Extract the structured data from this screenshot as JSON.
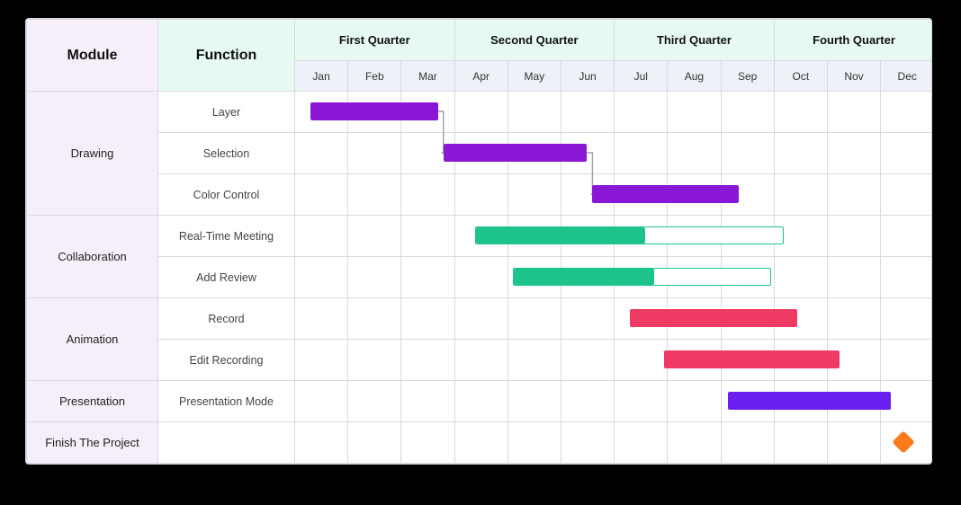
{
  "headers": {
    "module": "Module",
    "function": "Function",
    "quarters": [
      "First Quarter",
      "Second Quarter",
      "Third Quarter",
      "Fourth Quarter"
    ],
    "months": [
      "Jan",
      "Feb",
      "Mar",
      "Apr",
      "May",
      "Jun",
      "Jul",
      "Aug",
      "Sep",
      "Oct",
      "Nov",
      "Dec"
    ]
  },
  "modules": [
    {
      "name": "Drawing",
      "rows": [
        "Layer",
        "Selection",
        "Color Control"
      ]
    },
    {
      "name": "Collaboration",
      "rows": [
        "Real-Time Meeting",
        "Add Review"
      ]
    },
    {
      "name": "Animation",
      "rows": [
        "Record",
        "Edit Recording"
      ]
    },
    {
      "name": "Presentation",
      "rows": [
        "Presentation Mode"
      ]
    },
    {
      "name": "Finish The Project",
      "rows": [
        ""
      ]
    }
  ],
  "colors": {
    "drawing": "#8b17d6",
    "collab": "#1cc48a",
    "anim": "#ef3a63",
    "present": "#6a1ef0",
    "milestone": "#ff7a1a"
  },
  "chart_data": {
    "type": "bar",
    "subtype": "gantt",
    "x_categories": [
      "Jan",
      "Feb",
      "Mar",
      "Apr",
      "May",
      "Jun",
      "Jul",
      "Aug",
      "Sep",
      "Oct",
      "Nov",
      "Dec"
    ],
    "tasks": [
      {
        "module": "Drawing",
        "function": "Layer",
        "start": 0.3,
        "end": 2.7,
        "color": "drawing",
        "progress": 1.0
      },
      {
        "module": "Drawing",
        "function": "Selection",
        "start": 2.8,
        "end": 5.5,
        "color": "drawing",
        "progress": 1.0
      },
      {
        "module": "Drawing",
        "function": "Color Control",
        "start": 5.6,
        "end": 8.35,
        "color": "drawing",
        "progress": 1.0
      },
      {
        "module": "Collaboration",
        "function": "Real-Time Meeting",
        "start": 3.4,
        "end": 9.2,
        "color": "collab",
        "progress": 0.55
      },
      {
        "module": "Collaboration",
        "function": "Add Review",
        "start": 4.1,
        "end": 8.95,
        "color": "collab",
        "progress": 0.55
      },
      {
        "module": "Animation",
        "function": "Record",
        "start": 6.3,
        "end": 9.45,
        "color": "anim",
        "progress": 1.0
      },
      {
        "module": "Animation",
        "function": "Edit Recording",
        "start": 6.95,
        "end": 10.25,
        "color": "anim",
        "progress": 1.0
      },
      {
        "module": "Presentation",
        "function": "Presentation Mode",
        "start": 8.15,
        "end": 11.2,
        "color": "present",
        "progress": 1.0
      }
    ],
    "milestones": [
      {
        "module": "Finish The Project",
        "at": 11.45,
        "color": "milestone"
      }
    ],
    "dependencies": [
      {
        "from": "Layer",
        "to": "Selection"
      },
      {
        "from": "Selection",
        "to": "Color Control"
      }
    ]
  }
}
